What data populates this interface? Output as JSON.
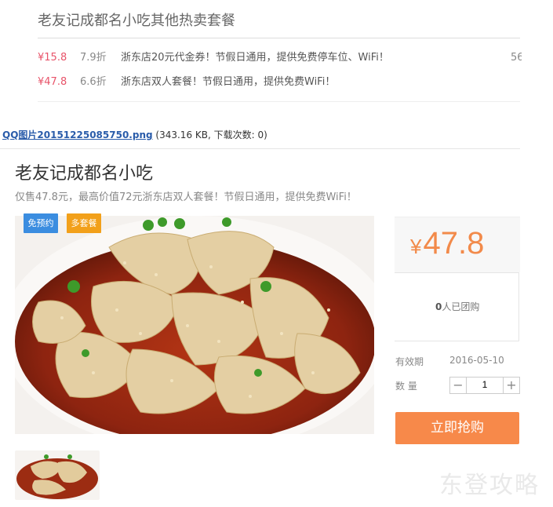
{
  "other": {
    "title": "老友记成都名小吃其他热卖套餐",
    "deals": [
      {
        "price": "¥15.8",
        "discount": "7.9折",
        "desc": "浙东店20元代金券！节假日通用，提供免费停车位、WiFi！",
        "more": "56"
      },
      {
        "price": "¥47.8",
        "discount": "6.6折",
        "desc": "浙东店双人套餐！节假日通用，提供免费WiFi！",
        "more": ""
      }
    ]
  },
  "attachment": {
    "link_text": "QQ图片20151225085750.png",
    "info": " (343.16 KB, 下载次数: 0)"
  },
  "product": {
    "title": "老友记成都名小吃",
    "subtitle": "仅售47.8元，最高价值72元浙东店双人套餐！节假日通用，提供免费WiFi！",
    "badges": {
      "book": "免预约",
      "set": "多套餐"
    },
    "price_symbol": "¥",
    "price_value": "47.8",
    "sold_count": "0",
    "sold_suffix": "人已团购",
    "validity_label": "有效期",
    "validity_value": "2016-05-10",
    "quantity_label": "数 量",
    "quantity_value": "1",
    "minus": "−",
    "plus": "+",
    "buy_label": "立即抢购"
  },
  "watermark": "东登攻略",
  "colors": {
    "accent": "#f7894a",
    "price_red": "#e8546a",
    "badge_blue": "#3b8de0",
    "badge_orange": "#f2a01a"
  }
}
